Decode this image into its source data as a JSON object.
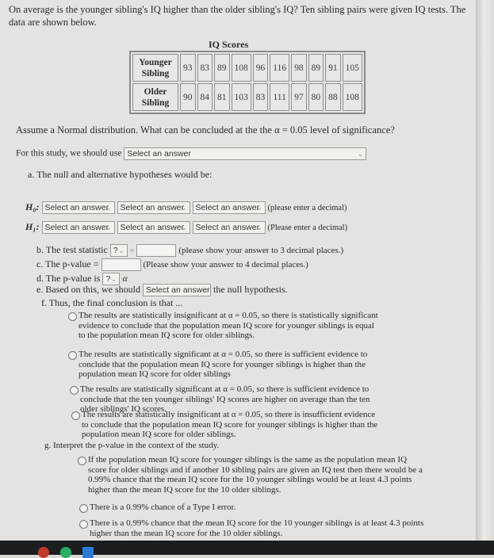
{
  "question": {
    "intro": "On average is the younger sibling's IQ higher than the older sibling's IQ? Ten sibling pairs were given IQ tests. The data are shown below."
  },
  "table": {
    "title": "IQ Scores",
    "rows": [
      {
        "label_line1": "Younger",
        "label_line2": "Sibling",
        "values": [
          "93",
          "83",
          "89",
          "108",
          "96",
          "116",
          "98",
          "89",
          "91",
          "105"
        ]
      },
      {
        "label_line1": "Older",
        "label_line2": "Sibling",
        "values": [
          "90",
          "84",
          "81",
          "103",
          "83",
          "111",
          "97",
          "80",
          "88",
          "108"
        ]
      }
    ]
  },
  "assume_text": "Assume a Normal distribution.  What can be concluded at the the α = 0.05 level of significance?",
  "study": {
    "label": "For this study, we should use",
    "select_value": "Select an answer"
  },
  "part_a": {
    "label": "a.  The null and alternative hypotheses would be:",
    "h0": {
      "symbol": "H₀:",
      "selects": [
        "Select an answer",
        "Select an answer",
        "Select an answer"
      ],
      "note": "(please enter a decimal)"
    },
    "h1": {
      "symbol": "H₁:",
      "selects": [
        "Select an answer",
        "Select an answer",
        "Select an answer"
      ],
      "note": "(Please enter a decimal)"
    }
  },
  "part_b": {
    "label": "b.  The test statistic",
    "select_value": "?",
    "equals": "=",
    "input_value": "",
    "note": "(please show your answer to 3 decimal places.)"
  },
  "part_c": {
    "label": "c.  The p-value =",
    "input_value": "",
    "note": "(Please show your answer to 4 decimal places.)"
  },
  "part_d": {
    "label": "d.  The p-value is",
    "select_value": "?",
    "suffix": "α"
  },
  "part_e": {
    "label": "e.  Based on this, we should",
    "select_value": "Select an answer",
    "suffix": "the null hypothesis."
  },
  "part_f": {
    "label": "f.  Thus, the final conclusion is that ...",
    "options": [
      "The results are statistically insignificant at α = 0.05, so there is statistically significant evidence to conclude that the population mean IQ score for younger siblings is equal to the population mean IQ score for older siblings.",
      "The results are statistically significant at α = 0.05, so there is sufficient evidence to conclude that the population mean IQ score for younger siblings is higher than the population mean IQ score for older siblings",
      "The results are statistically significant at α = 0.05, so there is sufficient evidence to conclude that the ten younger siblings' IQ scores are higher on average than the ten older siblings' IQ scores.",
      "The results are statistically insignificant at α = 0.05, so there is insufficient evidence to conclude that the population mean IQ score for younger siblings is higher than the population mean IQ score for older siblings."
    ]
  },
  "part_g": {
    "label": "g.  Interpret the p-value in the context of the study.",
    "options": [
      "If the population mean IQ score for younger siblings is the same as the population mean IQ score for older siblings and if another 10 sibling pairs are given an IQ test then there would be a 0.99% chance that the mean IQ score for the 10 younger siblings would be at least 4.3 points higher than the mean IQ score for the 10 older siblings.",
      "There is a 0.99% chance of a Type I error.",
      "There is a 0.99% chance that the mean IQ score for the 10 younger siblings is at least 4.3 points higher than the mean IQ score for the 10 older siblings."
    ]
  },
  "colors": {
    "taskbar_dots": [
      "#c0392b",
      "#27ae60",
      "#2e7bd6"
    ]
  }
}
